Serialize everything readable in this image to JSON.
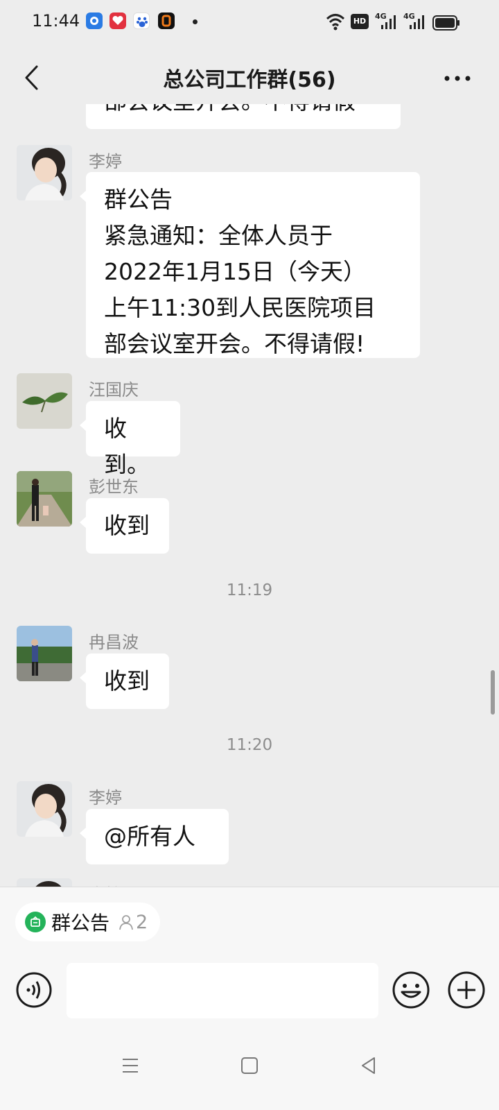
{
  "status_bar": {
    "time": "11:44",
    "hd_badge": "HD",
    "network_1": "4G",
    "network_2": "4G"
  },
  "header": {
    "title": "总公司工作群(56)"
  },
  "messages": {
    "partial_top": {
      "text": "部会议室开会。不得请假"
    },
    "m1": {
      "sender": "李婷",
      "text": "群公告\n紧急通知：全体人员于\n2022年1月15日（今天）\n上午11:30到人民医院项目\n部会议室开会。不得请假!"
    },
    "m2": {
      "sender": "汪国庆",
      "text": "收到。"
    },
    "m3": {
      "sender": "彭世东",
      "text": "收到"
    },
    "time_1": "11:19",
    "m4": {
      "sender": "冉昌波",
      "text": "收到"
    },
    "time_2": "11:20",
    "m5": {
      "sender": "李婷",
      "text": "@所有人"
    },
    "m6_partial": {
      "sender": "李婷"
    }
  },
  "pinned_notice": {
    "label": "群公告",
    "count": "2"
  },
  "input": {
    "placeholder": ""
  },
  "colors": {
    "background": "#ededed",
    "bubble": "#ffffff",
    "notice_green": "#24b35a",
    "secondary_text": "#8a8a8a"
  },
  "icons": [
    "back-arrow-icon",
    "more-dots-icon",
    "voice-icon",
    "emoji-icon",
    "plus-icon",
    "notice-icon",
    "person-icon",
    "menu-lines-icon",
    "home-square-icon",
    "back-triangle-icon"
  ]
}
